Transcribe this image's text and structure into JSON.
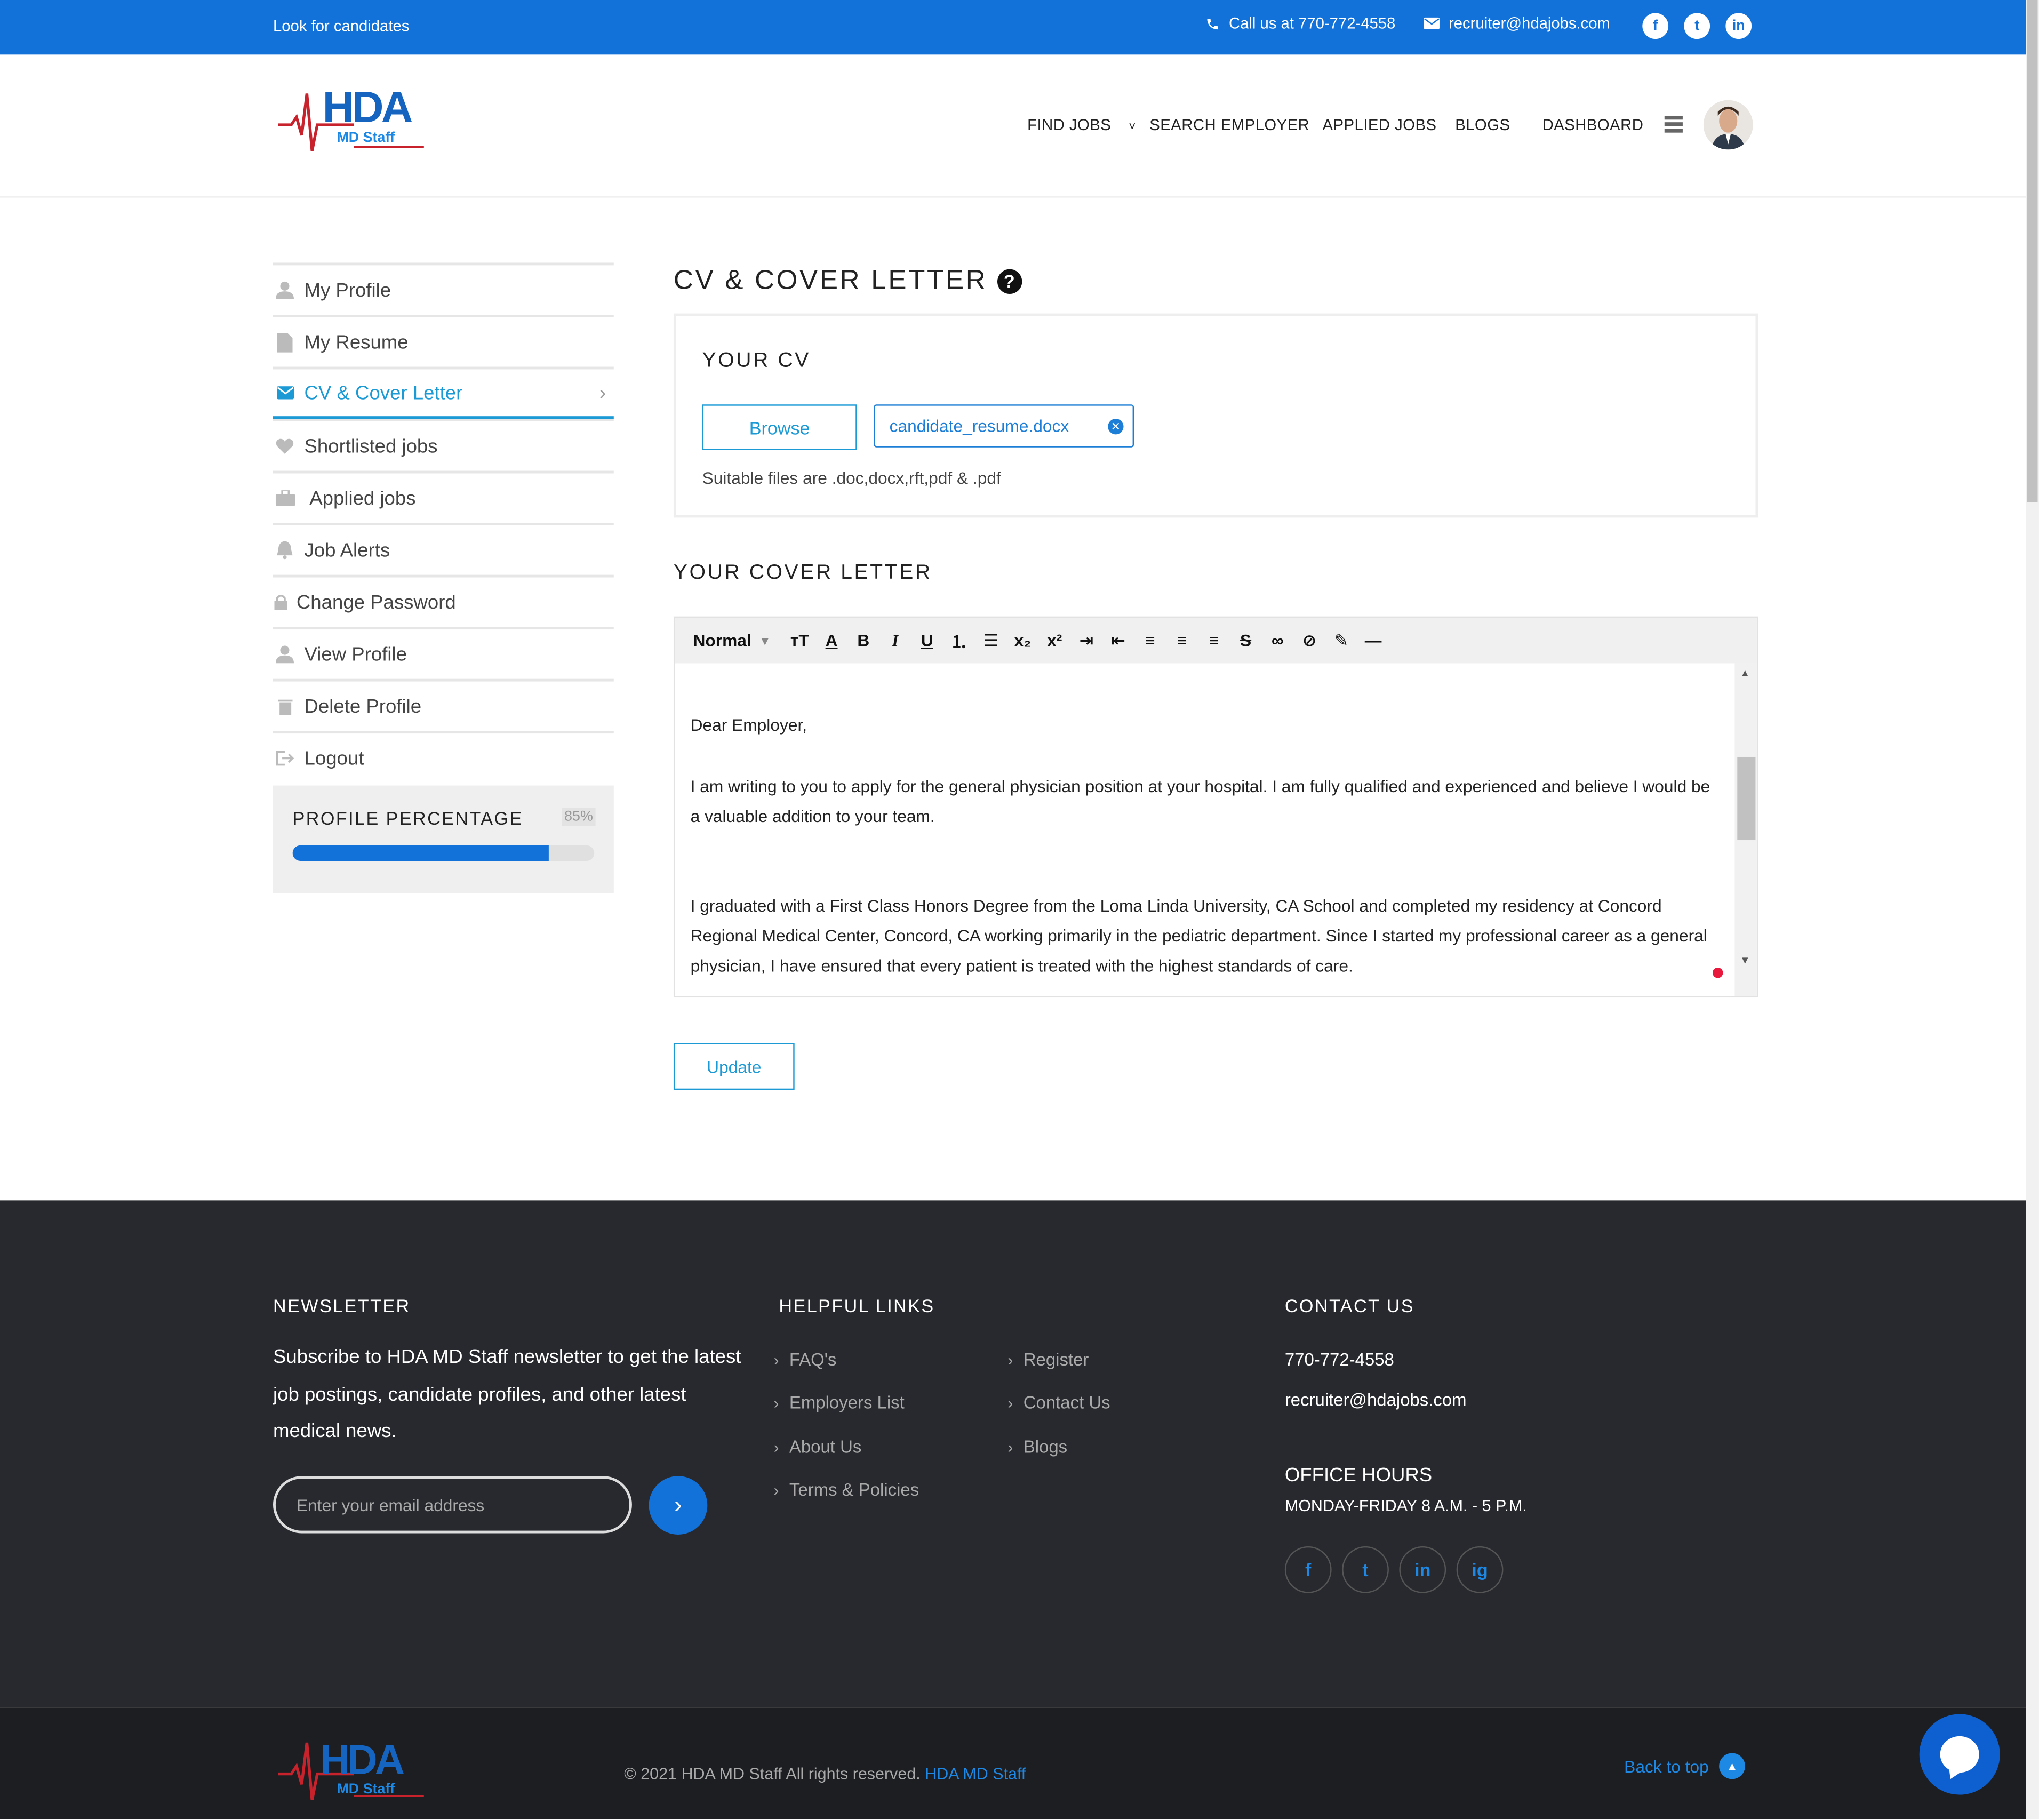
{
  "topbar": {
    "left_text": "Look for candidates",
    "phone": "Call us at 770-772-4558",
    "email": "recruiter@hdajobs.com",
    "social": [
      "f",
      "t",
      "in"
    ]
  },
  "logo": {
    "main": "HDA",
    "sub": "MD Staff"
  },
  "nav": {
    "items": [
      "FIND JOBS",
      "SEARCH EMPLOYER",
      "APPLIED JOBS",
      "BLOGS",
      "DASHBOARD"
    ]
  },
  "sidebar": {
    "items": [
      {
        "label": "My Profile",
        "icon": "user-icon"
      },
      {
        "label": "My Resume",
        "icon": "document-icon"
      },
      {
        "label": "CV & Cover Letter",
        "icon": "envelope-icon"
      },
      {
        "label": "Shortlisted jobs",
        "icon": "heart-icon"
      },
      {
        "label": "Applied jobs",
        "icon": "briefcase-icon"
      },
      {
        "label": "Job Alerts",
        "icon": "bell-icon"
      },
      {
        "label": "Change Password",
        "icon": "lock-icon"
      },
      {
        "label": "View Profile",
        "icon": "user-icon"
      },
      {
        "label": "Delete Profile",
        "icon": "trash-icon"
      },
      {
        "label": "Logout",
        "icon": "logout-icon"
      }
    ],
    "active_index": 2,
    "profile_percentage": {
      "label": "PROFILE PERCENTAGE",
      "value_text": "85%",
      "value": 85
    }
  },
  "main": {
    "title": "CV & COVER LETTER",
    "cv": {
      "heading": "YOUR CV",
      "browse_label": "Browse",
      "file_name": "candidate_resume.docx",
      "note": "Suitable files are .doc,docx,rft,pdf & .pdf"
    },
    "cover_letter": {
      "heading": "YOUR COVER LETTER",
      "format": "Normal",
      "paragraphs": [
        "Dear Employer,",
        "I am writing to you to apply for the general physician position at your hospital. I am fully qualified and experienced and believe I would be a valuable addition to your team.",
        "I graduated with a First Class Honors Degree from the Loma Linda University, CA School and completed my residency at Concord Regional Medical Center, Concord, CA working primarily in the pediatric department. Since I started my professional career as a general physician, I have ensured that every patient is treated with the highest standards of care."
      ]
    },
    "update_label": "Update"
  },
  "footer": {
    "newsletter": {
      "heading": "NEWSLETTER",
      "text": "Subscribe to HDA MD Staff newsletter to get the latest job postings, candidate profiles, and other latest medical news.",
      "placeholder": "Enter your email address"
    },
    "links": {
      "heading": "HELPFUL LINKS",
      "col1": [
        "FAQ's",
        "Employers List",
        "About Us",
        "Terms & Policies"
      ],
      "col2": [
        "Register",
        "Contact Us",
        "Blogs"
      ]
    },
    "contact": {
      "heading": "CONTACT US",
      "phone": "770-772-4558",
      "email": "recruiter@hdajobs.com",
      "hours_heading": "OFFICE HOURS",
      "hours": "MONDAY-FRIDAY 8 A.M. - 5 P.M.",
      "social": [
        "f",
        "t",
        "in",
        "ig"
      ]
    },
    "copyright": "© 2021 HDA MD Staff All rights reserved.",
    "copyright_brand": "HDA MD Staff",
    "back_to_top": "Back to top"
  },
  "colors": {
    "brand_blue": "#1372d9",
    "accent": "#1c9ad6",
    "footer_bg": "#27292e"
  }
}
